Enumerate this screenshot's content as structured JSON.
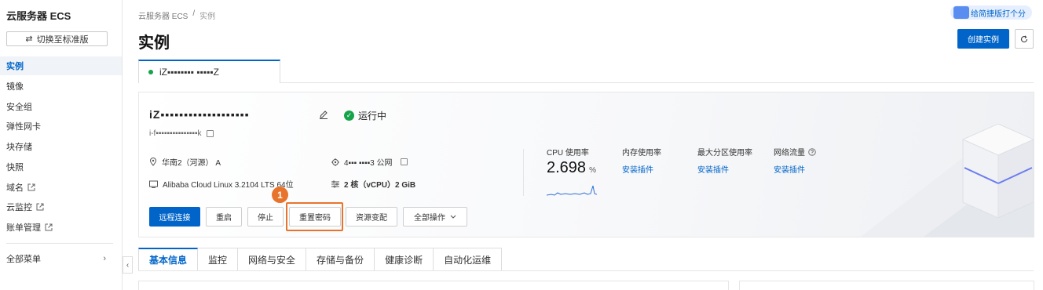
{
  "sidebar": {
    "title": "云服务器 ECS",
    "switch_label": "切换至标准版",
    "items": [
      {
        "label": "实例",
        "active": true
      },
      {
        "label": "镜像"
      },
      {
        "label": "安全组"
      },
      {
        "label": "弹性网卡"
      },
      {
        "label": "块存储"
      },
      {
        "label": "快照"
      },
      {
        "label": "域名",
        "external": true
      },
      {
        "label": "云监控",
        "external": true
      },
      {
        "label": "账单管理",
        "external": true
      }
    ],
    "all_menu": "全部菜单"
  },
  "breadcrumb": {
    "root": "云服务器 ECS",
    "sep": "/",
    "current": "实例"
  },
  "page_title": "实例",
  "rating_label": "给简捷版打个分",
  "create_button": "创建实例",
  "instance_tab_label": "iZ▪▪▪▪▪▪▪▪ ▪▪▪▪▪Z",
  "instance": {
    "name": "iZ▪▪▪▪▪▪▪▪▪▪▪▪▪▪▪▪▪▪▪",
    "status": "运行中",
    "id": "i-f▪▪▪▪▪▪▪▪▪▪▪▪▪▪▪k",
    "region": "华南2（河源） A",
    "public_ip": "4▪▪▪ ▪▪▪▪3 公网",
    "os": "Alibaba Cloud Linux 3.2104 LTS 64位",
    "spec": "2 核（vCPU）2 GiB"
  },
  "metrics": {
    "cpu_label": "CPU 使用率",
    "cpu_value": "2.698",
    "cpu_unit": "%",
    "mem_label": "内存使用率",
    "mem_link": "安装插件",
    "disk_label": "最大分区使用率",
    "disk_link": "安装插件",
    "net_label": "网络流量",
    "net_link": "安装插件"
  },
  "actions": {
    "remote": "远程连接",
    "restart": "重启",
    "stop": "停止",
    "reset_password": "重置密码",
    "resize": "资源变配",
    "all_ops": "全部操作"
  },
  "step_badge": "1",
  "detail_tabs": [
    "基本信息",
    "监控",
    "网络与安全",
    "存储与备份",
    "健康诊断",
    "自动化运维"
  ],
  "colors": {
    "primary": "#0064c8",
    "highlight": "#e8742c",
    "running": "#16a34a"
  }
}
